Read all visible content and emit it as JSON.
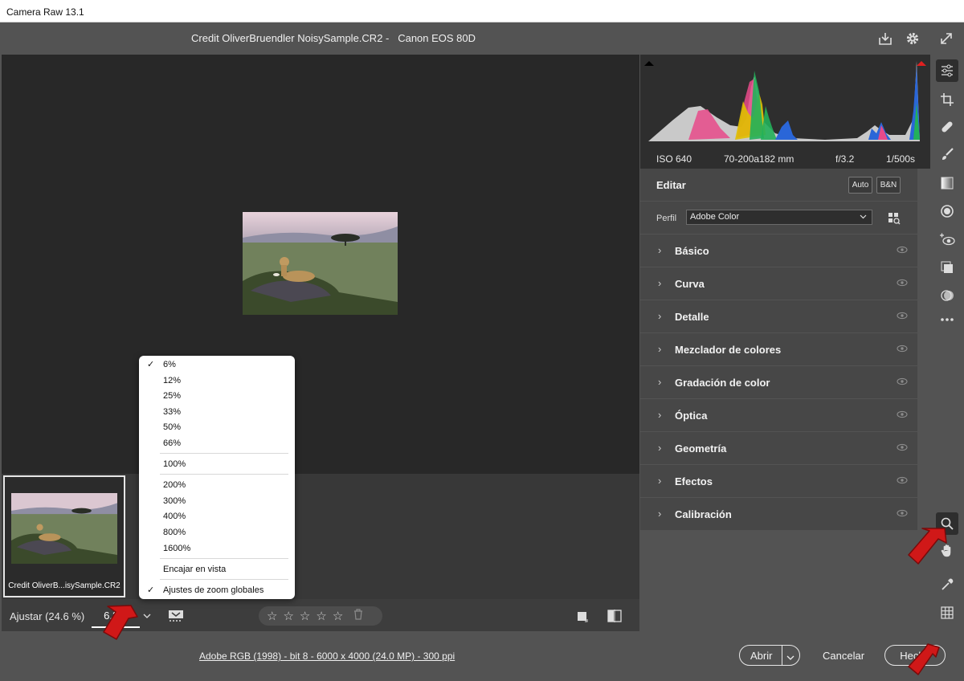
{
  "window": {
    "title": "Camera Raw 13.1"
  },
  "header": {
    "filename": "Credit OliverBruendler NoisySample.CR2 -   Canon EOS 80D"
  },
  "histogram": {
    "iso": "ISO 640",
    "lens": "70-200a182 mm",
    "aperture": "f/3.2",
    "shutter": "1/500s"
  },
  "edit": {
    "title": "Editar",
    "auto_label": "Auto",
    "bw_label": "B&N",
    "profile_label": "Perfil",
    "profile_value": "Adobe Color",
    "sections": [
      "Básico",
      "Curva",
      "Detalle",
      "Mezclador de colores",
      "Gradación de color",
      "Óptica",
      "Geometría",
      "Efectos",
      "Calibración"
    ]
  },
  "zoom_menu": {
    "items": [
      {
        "label": "6%",
        "checked": true
      },
      {
        "label": "12%"
      },
      {
        "label": "25%"
      },
      {
        "label": "33%"
      },
      {
        "label": "50%"
      },
      {
        "label": "66%"
      },
      {
        "label": "100%"
      },
      {
        "label": "200%"
      },
      {
        "label": "300%"
      },
      {
        "label": "400%"
      },
      {
        "label": "800%"
      },
      {
        "label": "1600%"
      },
      {
        "label": "Encajar en vista"
      },
      {
        "label": "Ajustes de zoom globales",
        "checked": true
      }
    ]
  },
  "filmstrip": {
    "caption": "Credit OliverB...isySample.CR2"
  },
  "bottombar": {
    "fit_label": "Ajustar (24.6 %)",
    "zoom_value": "6.3%"
  },
  "footer": {
    "info": "Adobe RGB (1998) - bit 8 - 6000 x 4000 (24.0 MP) - 300 ppi",
    "open_label": "Abrir",
    "cancel_label": "Cancelar",
    "done_label": "Hecho"
  },
  "colors": {
    "canvas": "#282828",
    "panel": "#474747",
    "chrome": "#535353",
    "annotation": "#d01818"
  }
}
